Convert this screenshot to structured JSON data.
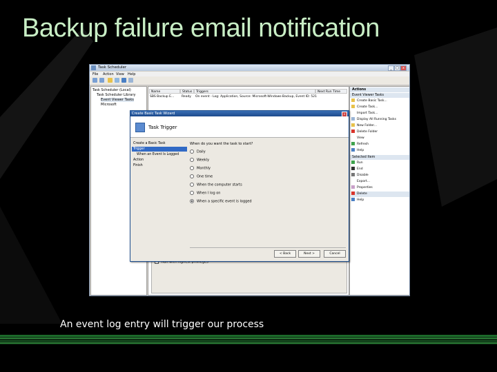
{
  "slide": {
    "title": "Backup failure email notification",
    "caption": "An event log entry will trigger our process",
    "background_color": "#000000",
    "title_color": "#c8eec5",
    "band_color": "#1c6a2a"
  },
  "window": {
    "title": "Task Scheduler",
    "menu": [
      "File",
      "Action",
      "View",
      "Help"
    ],
    "tree": {
      "root": "Task Scheduler (Local)",
      "library": "Task Scheduler Library",
      "selected": "Event Viewer Tasks",
      "child": "Microsoft"
    },
    "columns": [
      "Name",
      "Status",
      "Triggers",
      "Next Run Time"
    ],
    "row": {
      "name": "SBS Backup E...",
      "status": "Ready",
      "trigger": "On event - Log: Application, Source: Microsoft-Windows-Backup, Event ID: 521"
    },
    "bottom_option": "Run with highest privileges",
    "actions": {
      "header": "Actions",
      "section1": "Event Viewer Tasks",
      "items1": [
        "Create Basic Task...",
        "Create Task...",
        "Import Task...",
        "Display All Running Tasks",
        "New Folder...",
        "Delete Folder",
        "View",
        "Refresh",
        "Help"
      ],
      "section2": "Selected Item",
      "items2": [
        "Run",
        "End",
        "Disable",
        "Export...",
        "Properties",
        "Delete",
        "Help"
      ]
    }
  },
  "wizard": {
    "title": "Create Basic Task Wizard",
    "header": "Task Trigger",
    "steps": [
      "Create a Basic Task",
      "Trigger",
      "When an Event Is Logged",
      "Action",
      "Finish"
    ],
    "question": "When do you want the task to start?",
    "options": [
      "Daily",
      "Weekly",
      "Monthly",
      "One time",
      "When the computer starts",
      "When I log on",
      "When a specific event is logged"
    ],
    "selected_option": "When a specific event is logged",
    "back_label": "< Back",
    "next_label": "Next >",
    "cancel_label": "Cancel"
  }
}
